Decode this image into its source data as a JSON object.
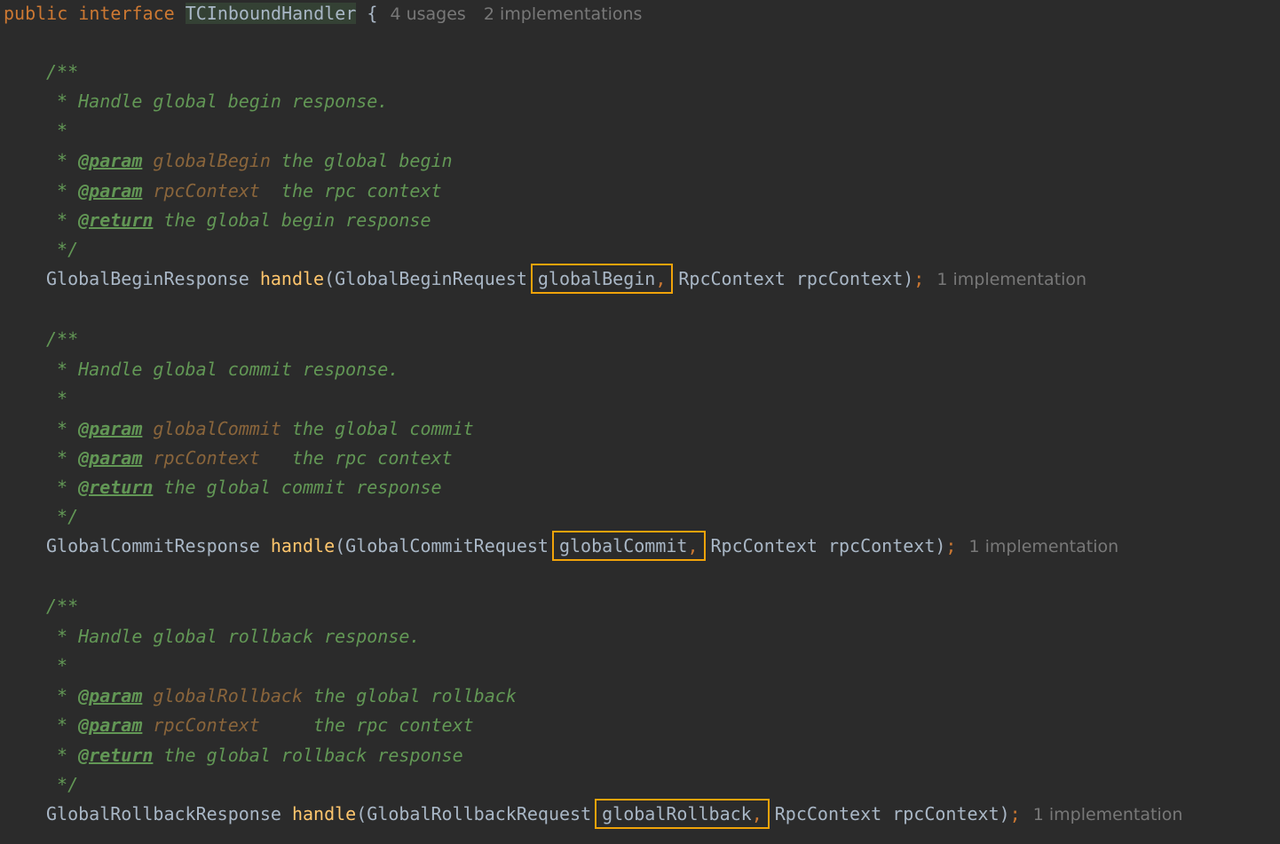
{
  "header": {
    "kw_public": "public",
    "kw_interface": "interface",
    "iface_name": "TCInboundHandler",
    "brace": "{",
    "usages": "4 usages",
    "implementations": "2 implementations"
  },
  "methods": [
    {
      "doc_open": "/**",
      "doc_summary": " * Handle global begin response.",
      "doc_blank": " *",
      "param1_tag": "@param",
      "param1_name": "globalBegin",
      "param1_desc": " the global begin",
      "param2_tag": "@param",
      "param2_name": "rpcContext",
      "param2_desc": "  the rpc context",
      "return_tag": "@return",
      "return_desc": " the global begin response",
      "doc_close": " */",
      "return_type": "GlobalBeginResponse",
      "method_name": "handle",
      "param1_type": "GlobalBeginRequest",
      "param1_var": "globalBegin",
      "param2": "RpcContext rpcContext",
      "hint": "1 implementation"
    },
    {
      "doc_open": "/**",
      "doc_summary": " * Handle global commit response.",
      "doc_blank": " *",
      "param1_tag": "@param",
      "param1_name": "globalCommit",
      "param1_desc": " the global commit",
      "param2_tag": "@param",
      "param2_name": "rpcContext",
      "param2_desc": "   the rpc context",
      "return_tag": "@return",
      "return_desc": " the global commit response",
      "doc_close": " */",
      "return_type": "GlobalCommitResponse",
      "method_name": "handle",
      "param1_type": "GlobalCommitRequest",
      "param1_var": "globalCommit",
      "param2": "RpcContext rpcContext",
      "hint": "1 implementation"
    },
    {
      "doc_open": "/**",
      "doc_summary": " * Handle global rollback response.",
      "doc_blank": " *",
      "param1_tag": "@param",
      "param1_name": "globalRollback",
      "param1_desc": " the global rollback",
      "param2_tag": "@param",
      "param2_name": "rpcContext",
      "param2_desc": "     the rpc context",
      "return_tag": "@return",
      "return_desc": " the global rollback response",
      "doc_close": " */",
      "return_type": "GlobalRollbackResponse",
      "method_name": "handle",
      "param1_type": "GlobalRollbackRequest",
      "param1_var": "globalRollback",
      "param2": "RpcContext rpcContext",
      "hint": "1 implementation"
    }
  ],
  "colors": {
    "background": "#2b2b2b",
    "keyword": "#cc7832",
    "method": "#ffc66d",
    "doc_comment": "#629755",
    "param_name": "#8a653b",
    "highlight_box": "#f0a30a",
    "inlay_hint": "#787878"
  }
}
